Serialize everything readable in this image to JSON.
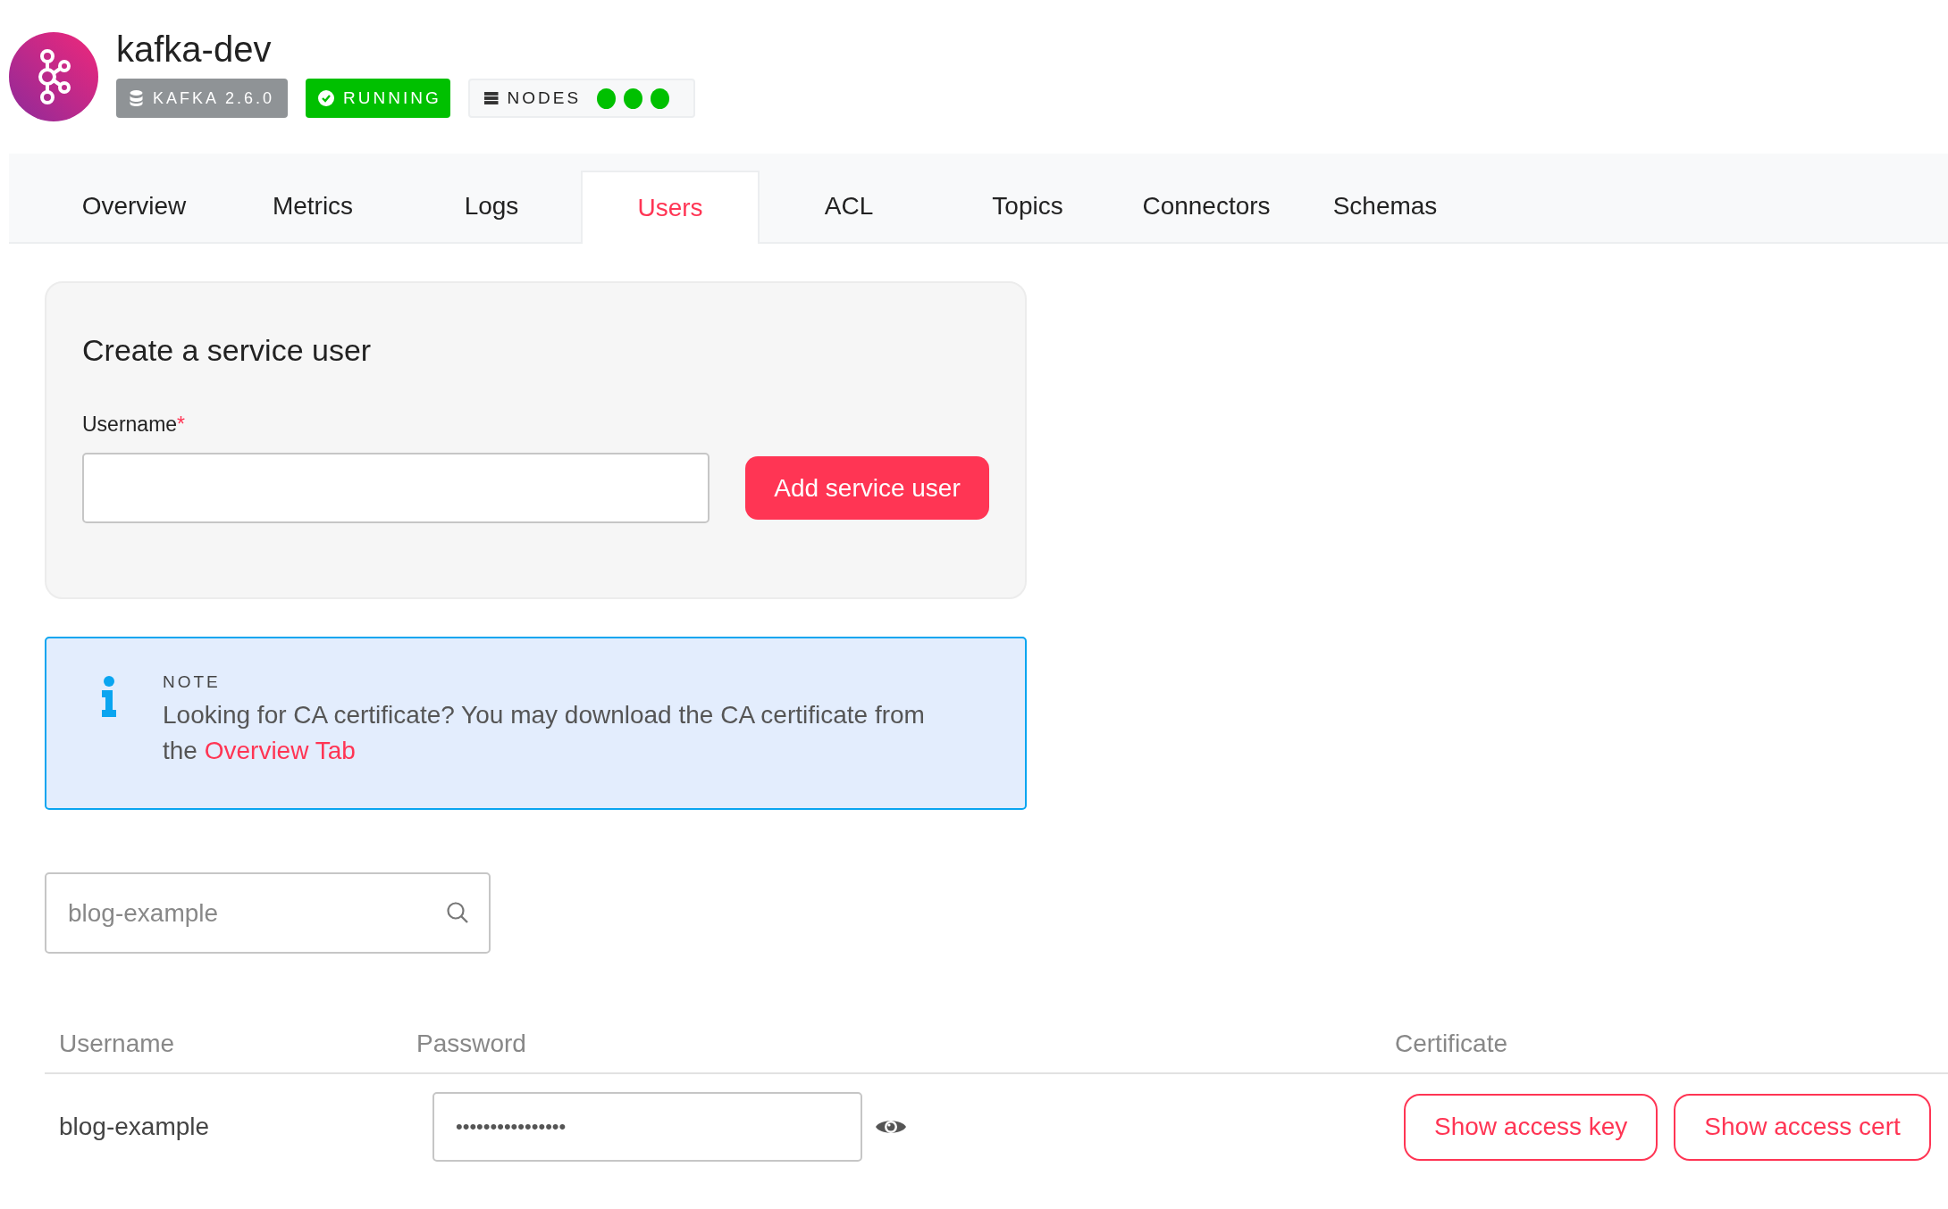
{
  "header": {
    "title": "kafka-dev",
    "version_badge": "KAFKA 2.6.0",
    "status_badge": "RUNNING",
    "nodes_label": "NODES",
    "nodes": [
      {
        "color": "#00c000"
      },
      {
        "color": "#00c000"
      },
      {
        "color": "#00c000"
      }
    ]
  },
  "tabs": [
    {
      "label": "Overview",
      "selected": false
    },
    {
      "label": "Metrics",
      "selected": false
    },
    {
      "label": "Logs",
      "selected": false
    },
    {
      "label": "Users",
      "selected": true
    },
    {
      "label": "ACL",
      "selected": false
    },
    {
      "label": "Topics",
      "selected": false
    },
    {
      "label": "Connectors",
      "selected": false
    },
    {
      "label": "Schemas",
      "selected": false
    }
  ],
  "create_form": {
    "title": "Create a service user",
    "label": "Username",
    "required_mark": "*",
    "button": "Add service user"
  },
  "note": {
    "heading": "NOTE",
    "text": "Looking for CA certificate? You may download the CA certificate from the",
    "link": "Overview Tab"
  },
  "search": {
    "placeholder": "blog-example"
  },
  "table": {
    "columns": [
      "Username",
      "Password",
      "Certificate"
    ],
    "rows": [
      {
        "username": "blog-example",
        "password": "••••••••••••••••",
        "buttons": [
          "Show access key",
          "Show access cert"
        ]
      }
    ]
  }
}
